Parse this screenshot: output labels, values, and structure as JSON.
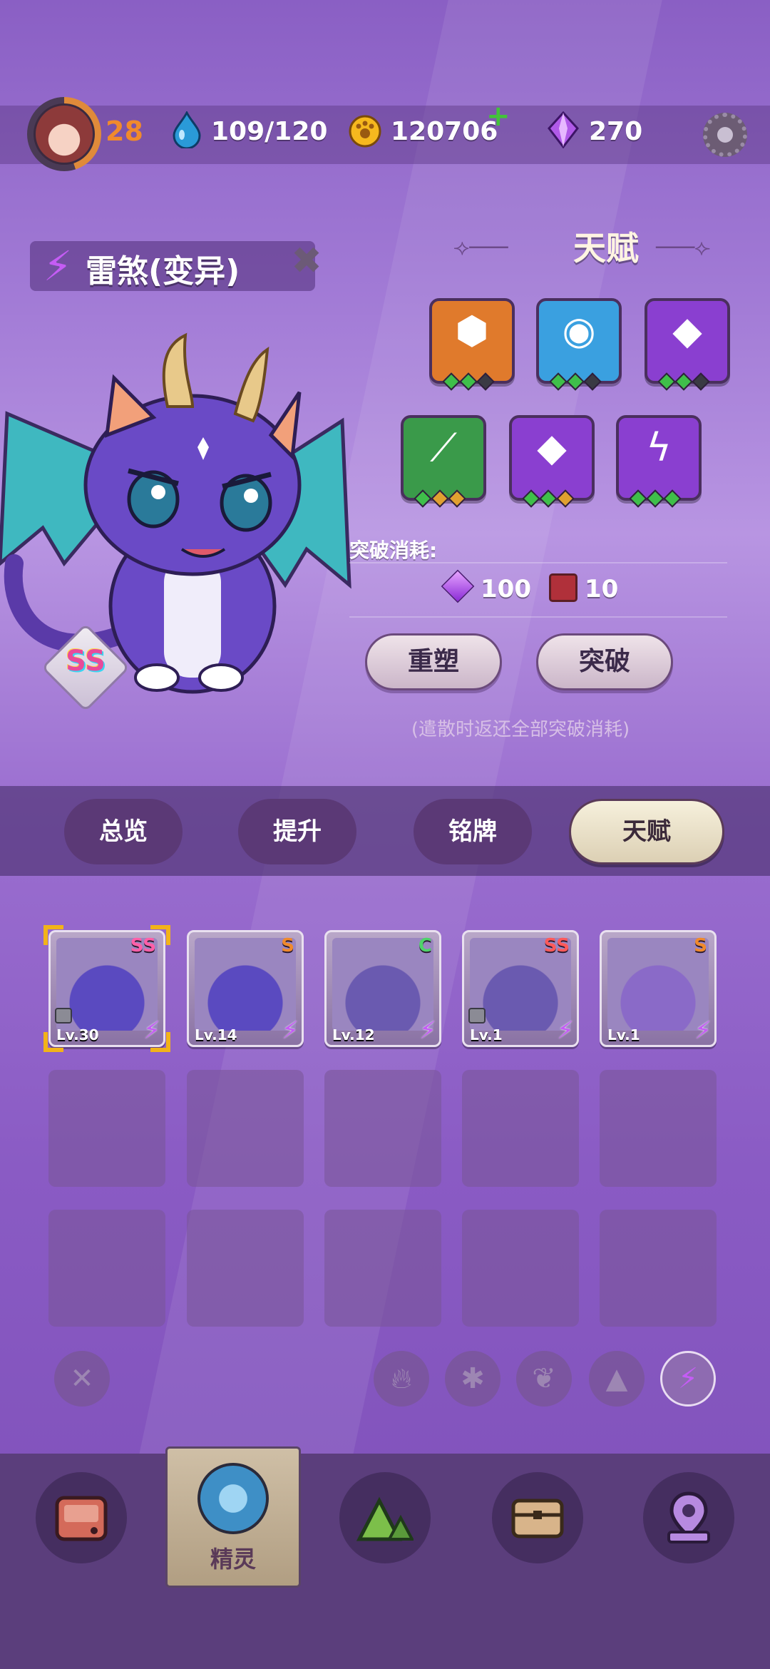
{
  "player": {
    "level": "28",
    "energy": "109/120",
    "coins": "120706",
    "gems": "270"
  },
  "pet": {
    "name": "雷煞(变异)",
    "grade": "SS"
  },
  "talent": {
    "title": "天赋",
    "tiles": [
      {
        "icon": "hexagon-icon",
        "color": "#e07a2c",
        "pips": [
          "#3fbf4a",
          "#3fbf4a",
          "#3a3a44"
        ]
      },
      {
        "icon": "eye-icon",
        "color": "#3aa0e0",
        "pips": [
          "#3fbf4a",
          "#3fbf4a",
          "#3a3a44"
        ]
      },
      {
        "icon": "tiles-icon",
        "color": "#8a3fd0",
        "pips": [
          "#3fbf4a",
          "#3fbf4a",
          "#3a3a44"
        ]
      },
      {
        "icon": "claw-icon",
        "color": "#3a9a4a",
        "pips": [
          "#3fbf4a",
          "#e0a030",
          "#e0a030"
        ]
      },
      {
        "icon": "tiles-icon",
        "color": "#8a3fd0",
        "pips": [
          "#3fbf4a",
          "#3fbf4a",
          "#e0a030"
        ]
      },
      {
        "icon": "lightning-icon",
        "color": "#8a3fd0",
        "pips": [
          "#3fbf4a",
          "#3fbf4a",
          "#3fbf4a"
        ]
      }
    ],
    "cost_label": "突破消耗:",
    "cost_gems": "100",
    "cost_books": "10",
    "reshape_label": "重塑",
    "breakthrough_label": "突破",
    "hint": "(遣散时返还全部突破消耗)"
  },
  "tabs": [
    {
      "label": "总览"
    },
    {
      "label": "提升"
    },
    {
      "label": "铭牌"
    },
    {
      "label": "天赋"
    }
  ],
  "roster": [
    {
      "level": "Lv.30",
      "grade": "SS",
      "grade_color": "#ff5fa8",
      "locked": true,
      "selected": true
    },
    {
      "level": "Lv.14",
      "grade": "S",
      "grade_color": "#f08a2c",
      "locked": false,
      "selected": false
    },
    {
      "level": "Lv.12",
      "grade": "C",
      "grade_color": "#4fd36a",
      "locked": false,
      "selected": false
    },
    {
      "level": "Lv.1",
      "grade": "SS",
      "grade_color": "#ff5a5a",
      "locked": true,
      "selected": false
    },
    {
      "level": "Lv.1",
      "grade": "S",
      "grade_color": "#f08a2c",
      "locked": false,
      "selected": false
    }
  ],
  "nav": {
    "active_label": "精灵"
  },
  "colors": {
    "accent": "#c55cf5",
    "gold": "#f2b319"
  }
}
